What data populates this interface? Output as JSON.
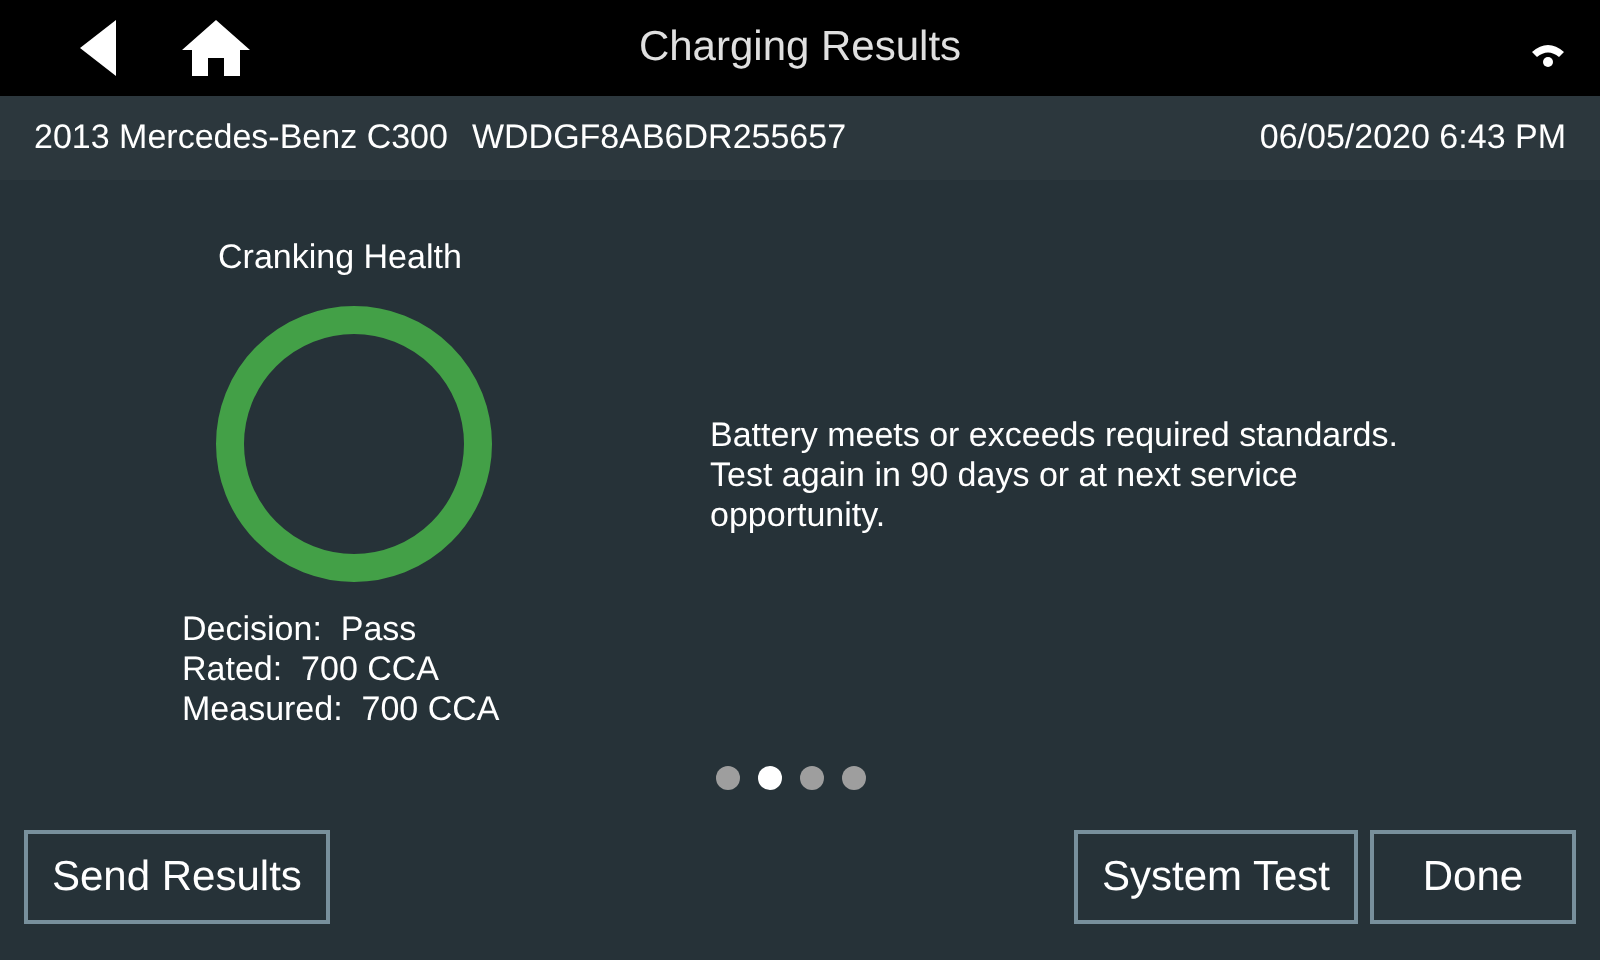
{
  "header": {
    "title": "Charging Results"
  },
  "info_bar": {
    "vehicle": "2013 Mercedes-Benz C300",
    "vin": "WDDGF8AB6DR255657",
    "datetime": "06/05/2020 6:43 PM"
  },
  "gauge": {
    "title": "Cranking Health",
    "level": 1,
    "color": "#43a047"
  },
  "details": [
    {
      "label": "Decision:",
      "value": "Pass"
    },
    {
      "label": "Rated:",
      "value": "700 CCA"
    },
    {
      "label": "Measured:",
      "value": "700 CCA"
    }
  ],
  "message": "Battery meets or exceeds required standards. Test again in 90 days or at next service opportunity.",
  "pages": [
    {
      "selected": false
    },
    {
      "selected": true
    },
    {
      "selected": false
    },
    {
      "selected": false
    }
  ],
  "buttons_left": [
    "Send Results"
  ],
  "buttons_right": [
    "System Test",
    "Done"
  ]
}
